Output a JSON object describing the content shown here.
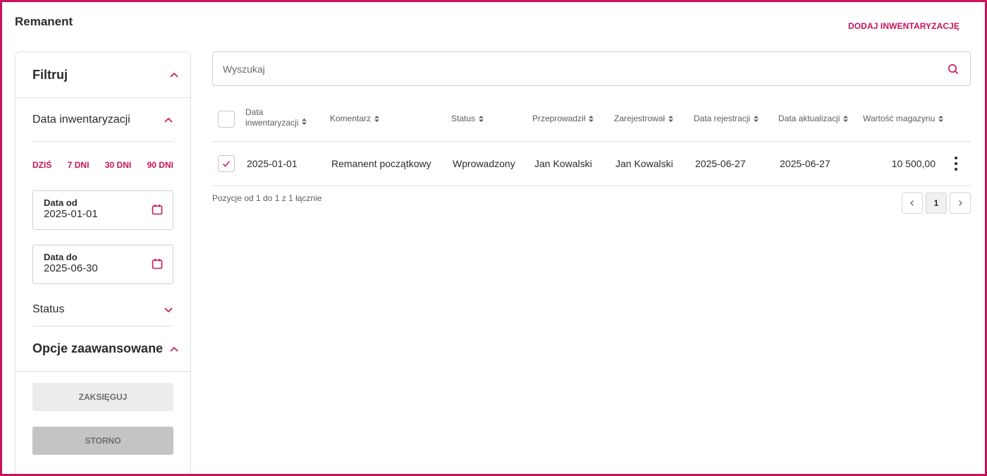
{
  "page": {
    "title": "Remanent",
    "add_button": "DODAJ INWENTARYZACJĘ"
  },
  "colors": {
    "accent": "#c8135a",
    "border": "#e0e0e0",
    "button_light": "#ececec",
    "button_dark": "#c4c4c4"
  },
  "sidebar": {
    "filter_title": "Filtruj",
    "date_section": {
      "label": "Data inwentaryzacji",
      "quick": [
        "DZIŚ",
        "7 DNI",
        "30 DNI",
        "90 DNI"
      ],
      "from": {
        "label": "Data od",
        "value": "2025-01-01"
      },
      "to": {
        "label": "Data do",
        "value": "2025-06-30"
      }
    },
    "status_label": "Status",
    "advanced_title": "Opcje zaawansowane",
    "book_button": "ZAKSIĘGUJ",
    "storno_button": "STORNO"
  },
  "search": {
    "placeholder": "Wyszukaj"
  },
  "table": {
    "headers": {
      "date_line1": "Data",
      "date_line2": "inwentaryzacji",
      "comment": "Komentarz",
      "status": "Status",
      "performed_by": "Przeprowadził",
      "registered_by": "Zarejestrował",
      "registration_date": "Data rejestracji",
      "update_date": "Data aktualizacji",
      "stock_value": "Wartość magazynu"
    },
    "rows": [
      {
        "checked": true,
        "date": "2025-01-01",
        "comment": "Remanent początkowy",
        "status": "Wprowadzony",
        "performed_by": "Jan Kowalski",
        "registered_by": "Jan Kowalski",
        "registration_date": "2025-06-27",
        "update_date": "2025-06-27",
        "stock_value": "10 500,00"
      }
    ]
  },
  "pagination": {
    "info": "Pozycje od 1 do 1 z 1 łącznie",
    "current_page": "1"
  }
}
